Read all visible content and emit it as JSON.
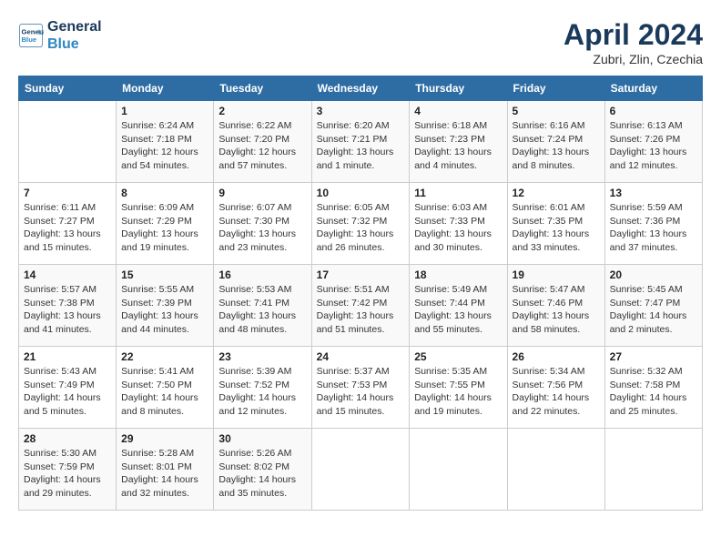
{
  "header": {
    "logo_line1": "General",
    "logo_line2": "Blue",
    "month_title": "April 2024",
    "location": "Zubri, Zlin, Czechia"
  },
  "weekdays": [
    "Sunday",
    "Monday",
    "Tuesday",
    "Wednesday",
    "Thursday",
    "Friday",
    "Saturday"
  ],
  "weeks": [
    [
      {
        "day": "",
        "info": ""
      },
      {
        "day": "1",
        "info": "Sunrise: 6:24 AM\nSunset: 7:18 PM\nDaylight: 12 hours\nand 54 minutes."
      },
      {
        "day": "2",
        "info": "Sunrise: 6:22 AM\nSunset: 7:20 PM\nDaylight: 12 hours\nand 57 minutes."
      },
      {
        "day": "3",
        "info": "Sunrise: 6:20 AM\nSunset: 7:21 PM\nDaylight: 13 hours\nand 1 minute."
      },
      {
        "day": "4",
        "info": "Sunrise: 6:18 AM\nSunset: 7:23 PM\nDaylight: 13 hours\nand 4 minutes."
      },
      {
        "day": "5",
        "info": "Sunrise: 6:16 AM\nSunset: 7:24 PM\nDaylight: 13 hours\nand 8 minutes."
      },
      {
        "day": "6",
        "info": "Sunrise: 6:13 AM\nSunset: 7:26 PM\nDaylight: 13 hours\nand 12 minutes."
      }
    ],
    [
      {
        "day": "7",
        "info": "Sunrise: 6:11 AM\nSunset: 7:27 PM\nDaylight: 13 hours\nand 15 minutes."
      },
      {
        "day": "8",
        "info": "Sunrise: 6:09 AM\nSunset: 7:29 PM\nDaylight: 13 hours\nand 19 minutes."
      },
      {
        "day": "9",
        "info": "Sunrise: 6:07 AM\nSunset: 7:30 PM\nDaylight: 13 hours\nand 23 minutes."
      },
      {
        "day": "10",
        "info": "Sunrise: 6:05 AM\nSunset: 7:32 PM\nDaylight: 13 hours\nand 26 minutes."
      },
      {
        "day": "11",
        "info": "Sunrise: 6:03 AM\nSunset: 7:33 PM\nDaylight: 13 hours\nand 30 minutes."
      },
      {
        "day": "12",
        "info": "Sunrise: 6:01 AM\nSunset: 7:35 PM\nDaylight: 13 hours\nand 33 minutes."
      },
      {
        "day": "13",
        "info": "Sunrise: 5:59 AM\nSunset: 7:36 PM\nDaylight: 13 hours\nand 37 minutes."
      }
    ],
    [
      {
        "day": "14",
        "info": "Sunrise: 5:57 AM\nSunset: 7:38 PM\nDaylight: 13 hours\nand 41 minutes."
      },
      {
        "day": "15",
        "info": "Sunrise: 5:55 AM\nSunset: 7:39 PM\nDaylight: 13 hours\nand 44 minutes."
      },
      {
        "day": "16",
        "info": "Sunrise: 5:53 AM\nSunset: 7:41 PM\nDaylight: 13 hours\nand 48 minutes."
      },
      {
        "day": "17",
        "info": "Sunrise: 5:51 AM\nSunset: 7:42 PM\nDaylight: 13 hours\nand 51 minutes."
      },
      {
        "day": "18",
        "info": "Sunrise: 5:49 AM\nSunset: 7:44 PM\nDaylight: 13 hours\nand 55 minutes."
      },
      {
        "day": "19",
        "info": "Sunrise: 5:47 AM\nSunset: 7:46 PM\nDaylight: 13 hours\nand 58 minutes."
      },
      {
        "day": "20",
        "info": "Sunrise: 5:45 AM\nSunset: 7:47 PM\nDaylight: 14 hours\nand 2 minutes."
      }
    ],
    [
      {
        "day": "21",
        "info": "Sunrise: 5:43 AM\nSunset: 7:49 PM\nDaylight: 14 hours\nand 5 minutes."
      },
      {
        "day": "22",
        "info": "Sunrise: 5:41 AM\nSunset: 7:50 PM\nDaylight: 14 hours\nand 8 minutes."
      },
      {
        "day": "23",
        "info": "Sunrise: 5:39 AM\nSunset: 7:52 PM\nDaylight: 14 hours\nand 12 minutes."
      },
      {
        "day": "24",
        "info": "Sunrise: 5:37 AM\nSunset: 7:53 PM\nDaylight: 14 hours\nand 15 minutes."
      },
      {
        "day": "25",
        "info": "Sunrise: 5:35 AM\nSunset: 7:55 PM\nDaylight: 14 hours\nand 19 minutes."
      },
      {
        "day": "26",
        "info": "Sunrise: 5:34 AM\nSunset: 7:56 PM\nDaylight: 14 hours\nand 22 minutes."
      },
      {
        "day": "27",
        "info": "Sunrise: 5:32 AM\nSunset: 7:58 PM\nDaylight: 14 hours\nand 25 minutes."
      }
    ],
    [
      {
        "day": "28",
        "info": "Sunrise: 5:30 AM\nSunset: 7:59 PM\nDaylight: 14 hours\nand 29 minutes."
      },
      {
        "day": "29",
        "info": "Sunrise: 5:28 AM\nSunset: 8:01 PM\nDaylight: 14 hours\nand 32 minutes."
      },
      {
        "day": "30",
        "info": "Sunrise: 5:26 AM\nSunset: 8:02 PM\nDaylight: 14 hours\nand 35 minutes."
      },
      {
        "day": "",
        "info": ""
      },
      {
        "day": "",
        "info": ""
      },
      {
        "day": "",
        "info": ""
      },
      {
        "day": "",
        "info": ""
      }
    ]
  ]
}
